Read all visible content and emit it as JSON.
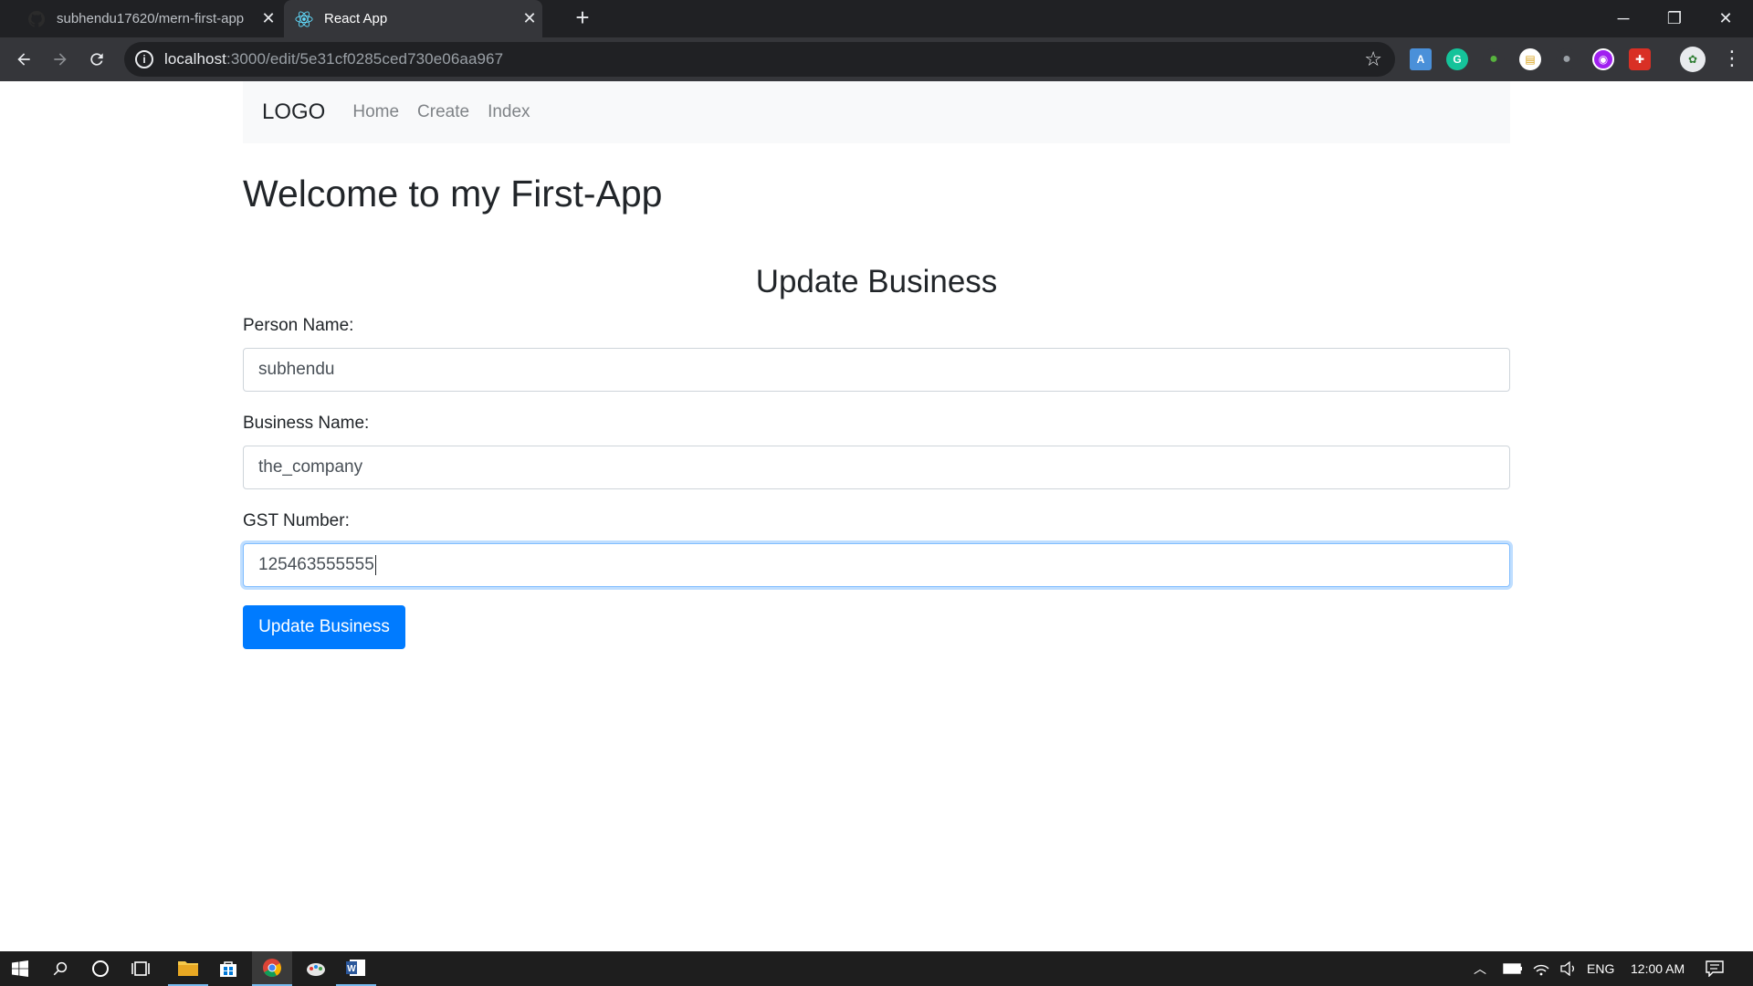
{
  "browser": {
    "tabs": [
      {
        "title": "subhendu17620/mern-first-app",
        "icon": "github-icon",
        "active": false
      },
      {
        "title": "React App",
        "icon": "react-icon",
        "active": true
      }
    ],
    "new_tab_symbol": "+",
    "close_symbol": "✕",
    "window_controls": {
      "minimize": "─",
      "restore": "❐",
      "close": "✕"
    },
    "url_host": "localhost",
    "url_path": ":3000/edit/5e31cf0285ced730e06aa967",
    "extensions": [
      "translate-icon",
      "grammarly-icon",
      "extension-green-icon",
      "notes-icon",
      "mouse-icon",
      "extension-purple-icon",
      "extension-red-icon",
      "profile-avatar-icon"
    ]
  },
  "app": {
    "brand": "LOGO",
    "nav": [
      {
        "label": "Home"
      },
      {
        "label": "Create"
      },
      {
        "label": "Index"
      }
    ],
    "heading": "Welcome to my First-App",
    "form_title": "Update Business",
    "fields": [
      {
        "label": "Person Name:",
        "value": "subhendu"
      },
      {
        "label": "Business Name:",
        "value": "the_company"
      },
      {
        "label": "GST Number:",
        "value": "125463555555"
      }
    ],
    "submit_label": "Update Business"
  },
  "taskbar": {
    "language": "ENG",
    "time": "12:00 AM"
  },
  "colors": {
    "primary": "#007bff",
    "navbar_bg": "#f8f9fa",
    "chrome_dark": "#202124",
    "chrome_toolbar": "#35363a"
  }
}
